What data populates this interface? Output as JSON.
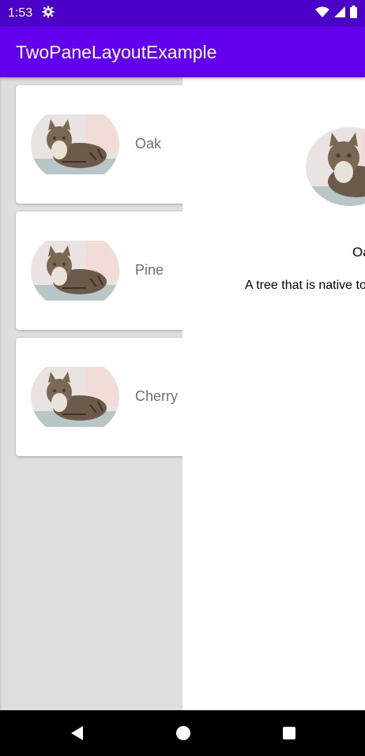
{
  "status_bar": {
    "time": "1:53",
    "icons": [
      "settings-icon",
      "wifi-icon",
      "cellular-signal-icon",
      "battery-icon"
    ]
  },
  "app_bar": {
    "title": "TwoPaneLayoutExample"
  },
  "list": {
    "items": [
      {
        "label": "Oak",
        "image": "cat-photo"
      },
      {
        "label": "Pine",
        "image": "cat-photo"
      },
      {
        "label": "Cherry",
        "image": "cat-photo"
      }
    ]
  },
  "detail": {
    "image": "cat-photo",
    "title": "Oak",
    "description": "A tree that is native to the Northern Hemisphere"
  },
  "nav_bar": {
    "buttons": [
      "back-icon",
      "home-icon",
      "recents-icon"
    ]
  },
  "colors": {
    "status_bar": "#4b00c8",
    "app_bar": "#6200ee",
    "list_background": "#dedede",
    "card": "#ffffff",
    "label_text": "#6f6f6f"
  }
}
